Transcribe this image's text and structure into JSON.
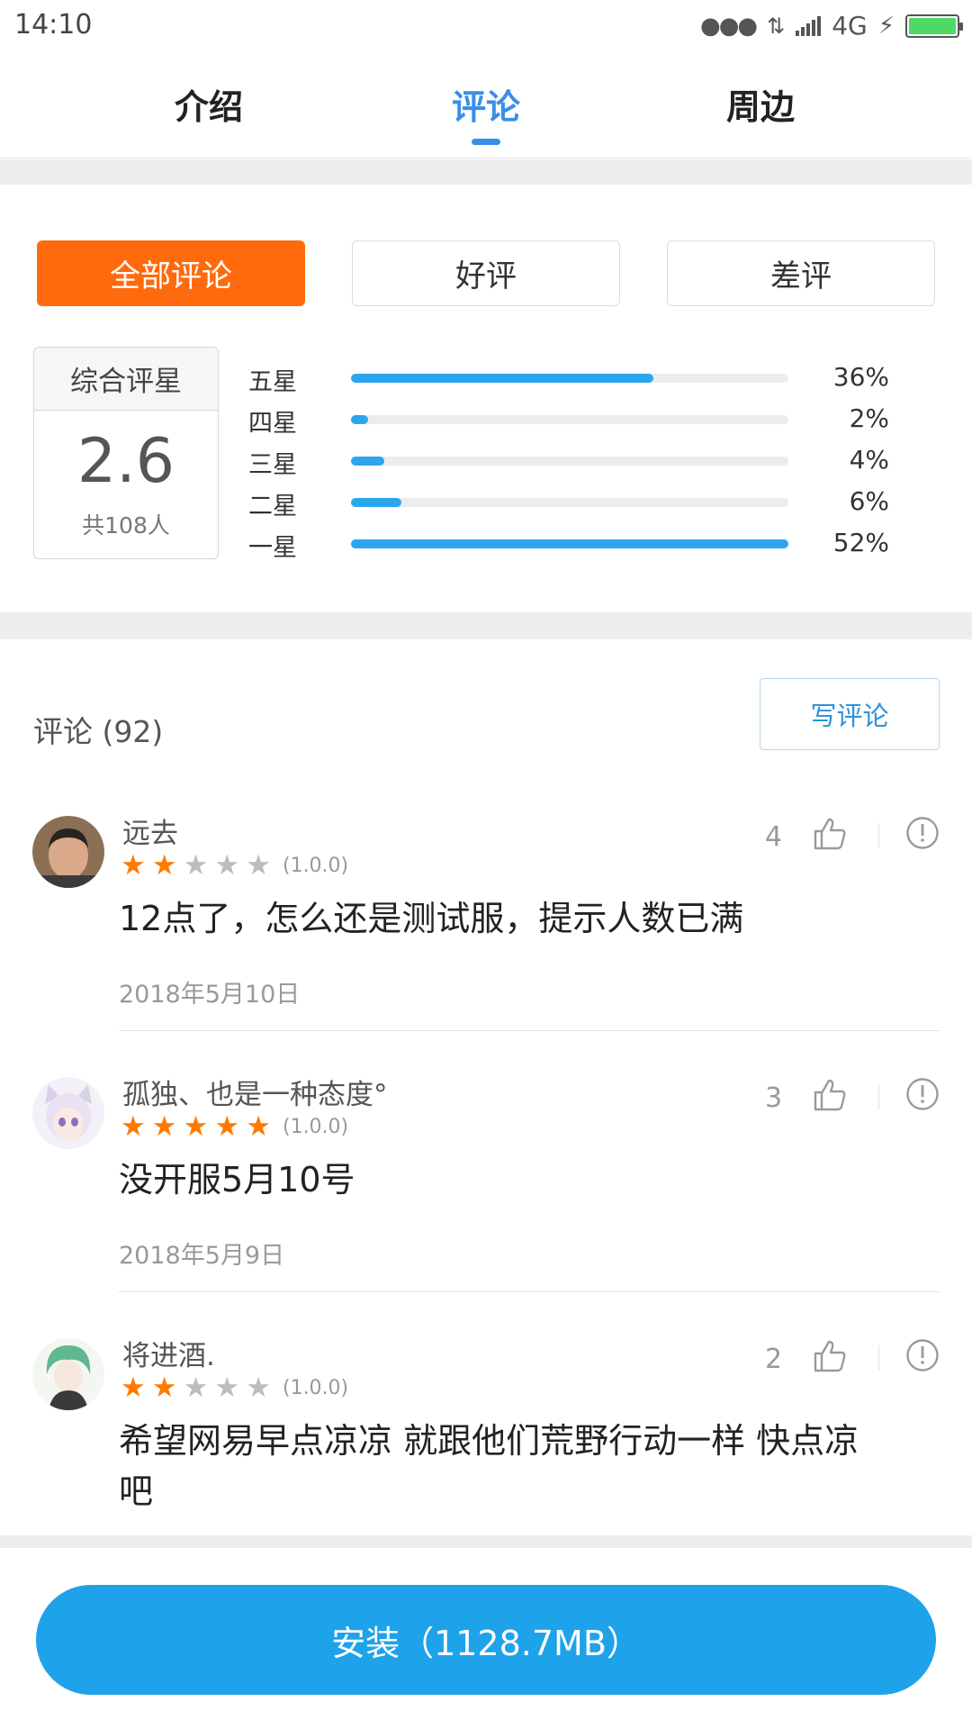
{
  "status_bar": {
    "time": "14:10",
    "network": "4G"
  },
  "tabs": [
    {
      "label": "介绍",
      "active": false
    },
    {
      "label": "评论",
      "active": true
    },
    {
      "label": "周边",
      "active": false
    }
  ],
  "filters": [
    {
      "label": "全部评论",
      "active": true
    },
    {
      "label": "好评",
      "active": false
    },
    {
      "label": "差评",
      "active": false
    }
  ],
  "rating": {
    "title": "综合评星",
    "score": "2.6",
    "count": "共108人",
    "distribution": [
      {
        "label": "五星",
        "percent": 36,
        "percent_text": "36%"
      },
      {
        "label": "四星",
        "percent": 2,
        "percent_text": "2%"
      },
      {
        "label": "三星",
        "percent": 4,
        "percent_text": "4%"
      },
      {
        "label": "二星",
        "percent": 6,
        "percent_text": "6%"
      },
      {
        "label": "一星",
        "percent": 52,
        "percent_text": "52%"
      }
    ]
  },
  "comments_header": {
    "title": "评论 (92)",
    "write_button": "写评论"
  },
  "comments": [
    {
      "name": "远去",
      "stars": 2,
      "version": "(1.0.0)",
      "text": "12点了，怎么还是测试服，提示人数已满",
      "date": "2018年5月10日",
      "likes": "4"
    },
    {
      "name": "孤独、也是一种态度°",
      "stars": 5,
      "version": "(1.0.0)",
      "text": "没开服5月10号",
      "date": "2018年5月9日",
      "likes": "3"
    },
    {
      "name": "将进酒.",
      "stars": 2,
      "version": "(1.0.0)",
      "text": "希望网易早点凉凉 就跟他们荒野行动一样 快点凉吧",
      "date": "",
      "likes": "2"
    }
  ],
  "install": {
    "label": "安装（1128.7MB）"
  },
  "colors": {
    "accent_blue": "#3a8ee6",
    "orange": "#ff6a0c",
    "bar_blue": "#2ba6ee",
    "install_blue": "#1ea3ea"
  }
}
